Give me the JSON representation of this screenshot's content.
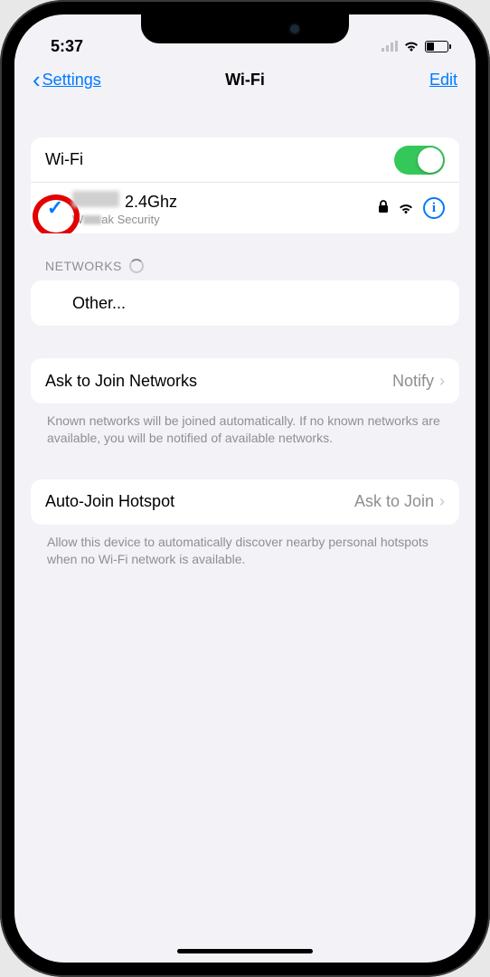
{
  "status": {
    "time": "5:37"
  },
  "nav": {
    "back": "Settings",
    "title": "Wi-Fi",
    "edit": "Edit"
  },
  "wifi": {
    "toggle_label": "Wi-Fi",
    "connected": {
      "name_suffix": "2.4Ghz",
      "sub_suffix": "ak Security"
    }
  },
  "networks_header": "NETWORKS",
  "other_label": "Other...",
  "ask_join": {
    "label": "Ask to Join Networks",
    "value": "Notify",
    "footer": "Known networks will be joined automatically. If no known networks are available, you will be notified of available networks."
  },
  "auto_hotspot": {
    "label": "Auto-Join Hotspot",
    "value": "Ask to Join",
    "footer": "Allow this device to automatically discover nearby personal hotspots when no Wi-Fi network is available."
  }
}
